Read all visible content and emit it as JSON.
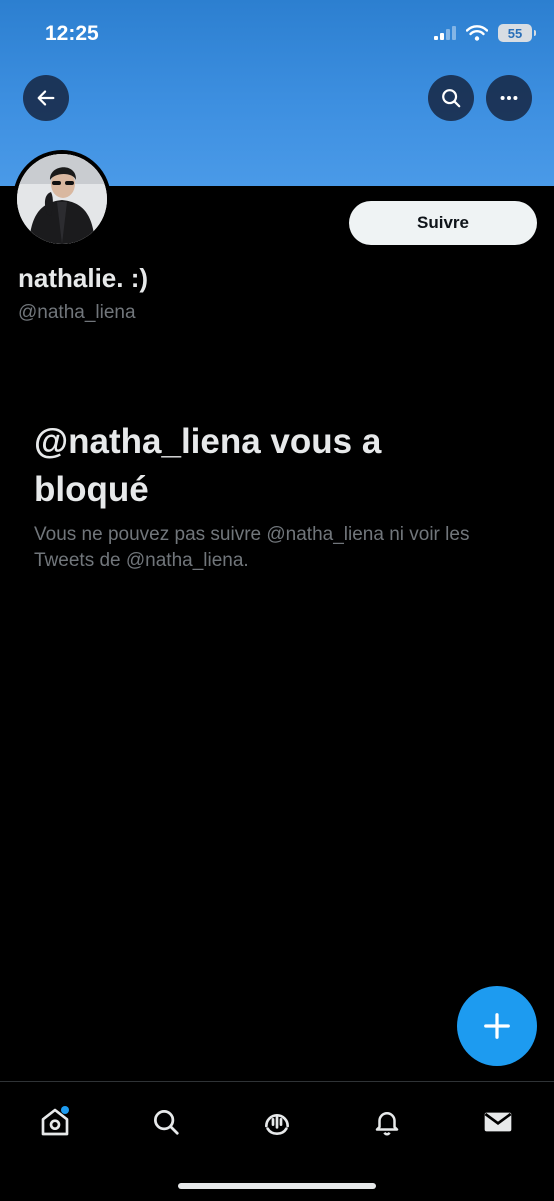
{
  "status_bar": {
    "time": "12:25",
    "battery": "55"
  },
  "profile": {
    "name": "nathalie. :)",
    "handle": "@natha_liena",
    "follow_label": "Suivre"
  },
  "blocked": {
    "title": "@natha_liena vous a bloqué",
    "description": "Vous ne pouvez pas suivre @natha_liena ni voir les Tweets de @natha_liena."
  },
  "colors": {
    "accent": "#1d9bf0",
    "banner": "#3d8fe0",
    "background": "#000000",
    "muted": "#71767b"
  },
  "icons": {
    "back": "arrow-left-icon",
    "search": "search-icon",
    "more": "more-icon",
    "compose": "plus-icon",
    "tabs": [
      "home-icon",
      "search-icon",
      "spaces-icon",
      "bell-icon",
      "mail-icon"
    ]
  }
}
